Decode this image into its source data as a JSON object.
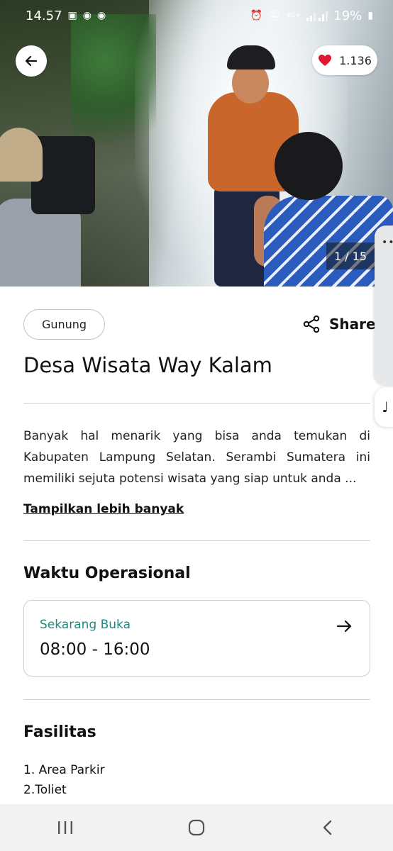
{
  "status_bar": {
    "time": "14.57",
    "battery": "19%",
    "network": "4G+"
  },
  "hero": {
    "like_count": "1.136",
    "photo_counter": "1 / 15"
  },
  "place": {
    "category": "Gunung",
    "share_label": "Share",
    "title": "Desa Wisata Way Kalam",
    "description": "Banyak hal menarik yang bisa anda temukan di Kabupaten Lampung Selatan. Serambi Sumatera ini memiliki sejuta potensi wisata yang siap untuk anda ...",
    "more_link": "Tampilkan lebih banyak"
  },
  "operating_hours": {
    "section_title": "Waktu Operasional",
    "status": "Sekarang Buka",
    "hours": "08:00 - 16:00"
  },
  "facilities": {
    "section_title": "Fasilitas",
    "items": [
      "1. Area Parkir",
      "2.Toliet"
    ]
  },
  "colors": {
    "accent_teal": "#1f8a7e",
    "heart_red": "#e0182d"
  }
}
